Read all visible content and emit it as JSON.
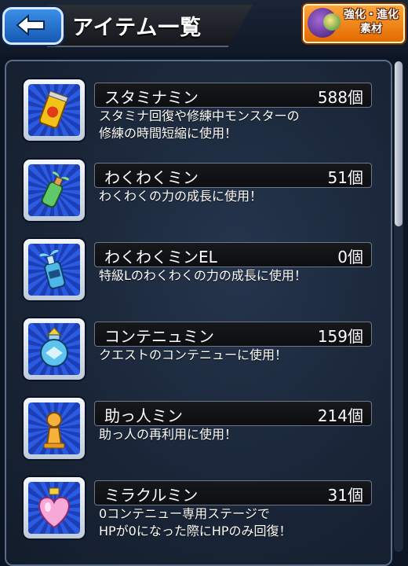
{
  "header": {
    "title": "アイテム一覧",
    "material_button": {
      "line1": "強化・進化",
      "line2": "素材"
    }
  },
  "items": [
    {
      "name": "スタミナミン",
      "quantity": "588個",
      "description": "スタミナ回復や修練中モンスターの\n修練の時間短縮に使用！",
      "icon": "stamina-can-icon"
    },
    {
      "name": "わくわくミン",
      "quantity": "51個",
      "description": "わくわくの力の成長に使用！",
      "icon": "sprout-bottle-icon"
    },
    {
      "name": "わくわくミンEL",
      "quantity": "0個",
      "description": "特級Lのわくわくの力の成長に使用！",
      "icon": "el-bottle-icon"
    },
    {
      "name": "コンテニュミン",
      "quantity": "159個",
      "description": "クエストのコンテニューに使用！",
      "icon": "continue-jar-icon"
    },
    {
      "name": "助っ人ミン",
      "quantity": "214個",
      "description": "助っ人の再利用に使用！",
      "icon": "helper-pawn-icon"
    },
    {
      "name": "ミラクルミン",
      "quantity": "31個",
      "description": "0コンテニュー専用ステージで\nHPが0になった際にHPのみ回復！",
      "icon": "heart-jar-icon"
    }
  ],
  "colors": {
    "accent_blue": "#2b5be0",
    "orange_button": "#e26a00",
    "panel": "#1a2638"
  }
}
